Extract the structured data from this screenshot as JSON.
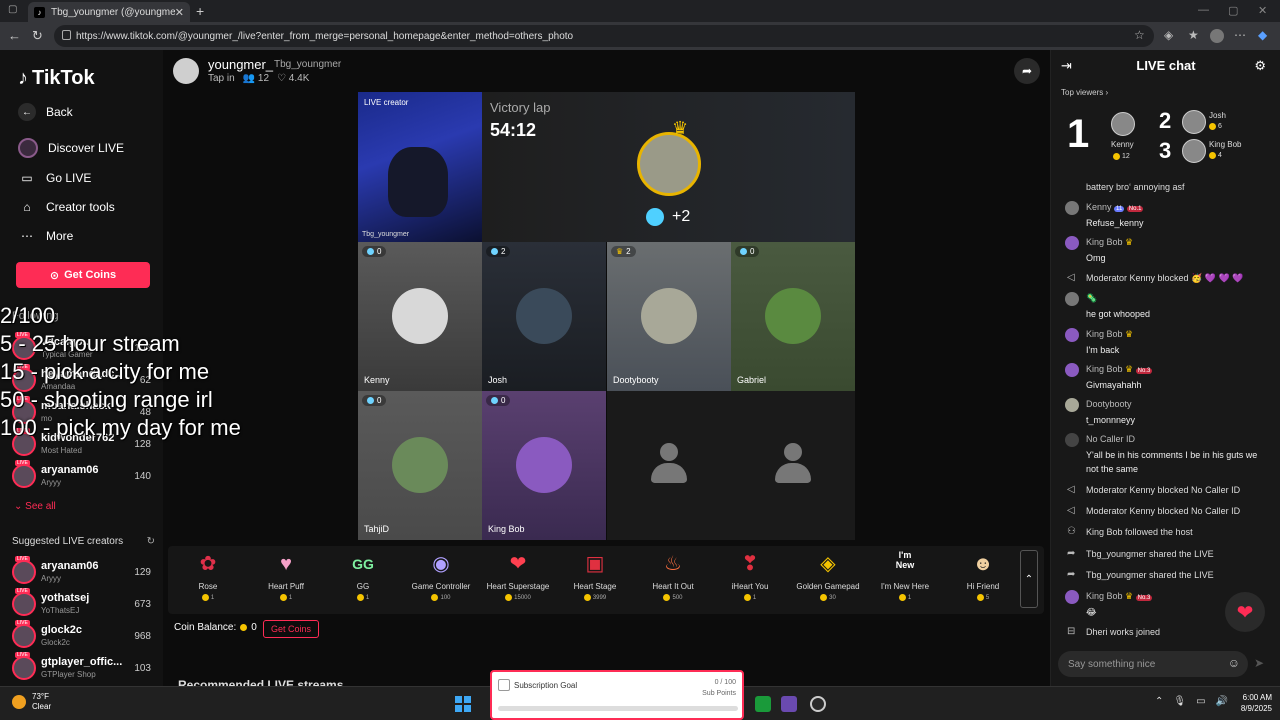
{
  "browser": {
    "tab_title": "Tbg_youngmer (@youngme...",
    "url": "https://www.tiktok.com/@youngmer_/live?enter_from_merge=personal_homepage&enter_method=others_photo"
  },
  "sidebar": {
    "logo": "TikTok",
    "nav": [
      {
        "label": "Back"
      },
      {
        "label": "Discover LIVE"
      },
      {
        "label": "Go LIVE"
      },
      {
        "label": "Creator tools"
      },
      {
        "label": "More"
      }
    ],
    "get_coins": "Get Coins",
    "following_title": "Following",
    "following": [
      {
        "name": "vdcalgo...",
        "sub": "Typical Gamer",
        "count": "106"
      },
      {
        "name": "heyamandadc...",
        "sub": "Amandaa",
        "count": "62"
      },
      {
        "name": "moana.shack",
        "sub": "mo",
        "count": "48"
      },
      {
        "name": "kidwonder762",
        "sub": "Most Hated",
        "count": "128"
      },
      {
        "name": "aryanam06",
        "sub": "Aryyy",
        "count": "140"
      }
    ],
    "see_all": "See all",
    "suggested_title": "Suggested LIVE creators",
    "suggested": [
      {
        "name": "aryanam06",
        "sub": "Aryyy",
        "count": "129"
      },
      {
        "name": "yothatsej",
        "sub": "YoThatsEJ",
        "count": "673"
      },
      {
        "name": "glock2c",
        "sub": "Glock2c",
        "count": "968"
      },
      {
        "name": "gtplayer_offic...",
        "sub": "GTPlayer Shop",
        "count": "103"
      }
    ]
  },
  "overlay": {
    "lines": [
      "2/100",
      "5 - 25 hour stream",
      "15 - pick a city for me",
      "50 - shooting range irl",
      "100 - pick my day for me"
    ]
  },
  "stream": {
    "name": "youngmer_",
    "handle": "Tbg_youngmer",
    "tap_in": "Tap in",
    "viewers": "12",
    "likes": "4.4K",
    "host_label": "LIVE creator",
    "host_name": "Tbg_youngmer",
    "victory_title": "Victory lap",
    "victory_timer": "54:12",
    "victory_plus": "+2",
    "guests": [
      {
        "name": "Kenny",
        "score": "0"
      },
      {
        "name": "Josh",
        "score": "2"
      },
      {
        "name": "Dootybooty",
        "score": "2"
      },
      {
        "name": "Gabriel",
        "score": "0"
      },
      {
        "name": "TahjiD",
        "score": "0"
      },
      {
        "name": "King Bob",
        "score": "0"
      }
    ]
  },
  "gifts": [
    {
      "name": "Rose",
      "price": "1"
    },
    {
      "name": "Heart Puff",
      "price": "1"
    },
    {
      "name": "GG",
      "price": "1"
    },
    {
      "name": "Game Controller",
      "price": "100"
    },
    {
      "name": "Heart Superstage",
      "price": "15000"
    },
    {
      "name": "Heart Stage",
      "price": "3999"
    },
    {
      "name": "Heart It Out",
      "price": "500"
    },
    {
      "name": "iHeart You",
      "price": "1"
    },
    {
      "name": "Golden Gamepad",
      "price": "30"
    },
    {
      "name": "I'm New Here",
      "price": "1"
    },
    {
      "name": "Hi Friend",
      "price": "5"
    }
  ],
  "balance_label": "Coin Balance:",
  "balance_value": "0",
  "get_coins2": "Get Coins",
  "recommended": "Recommended LIVE streams",
  "subgoal": {
    "title": "Subscription Goal",
    "value": "0 / 100",
    "unit": "Sub Points"
  },
  "chat": {
    "title": "LIVE chat",
    "top_viewers": "Top viewers",
    "top": [
      {
        "rank": "1",
        "name": "Kenny",
        "score": "12"
      },
      {
        "rank": "2",
        "name": "Josh",
        "score": "6"
      },
      {
        "rank": "3",
        "name": "King Bob",
        "score": "4"
      }
    ],
    "messages": [
      {
        "type": "text",
        "user": "",
        "text": "battery bro‘ annoying asf"
      },
      {
        "type": "user",
        "user": "Kenny",
        "badge": "11",
        "rank": "No.1",
        "text": "Refuse_kenny"
      },
      {
        "type": "user",
        "user": "King Bob",
        "text": "Omg"
      },
      {
        "type": "system",
        "text": "Moderator Kenny  blocked 🥳 💜 💜 💜"
      },
      {
        "type": "user",
        "user": "🦠",
        "text": "he got whooped"
      },
      {
        "type": "user",
        "user": "King Bob",
        "text": "I'm back"
      },
      {
        "type": "user",
        "user": "King Bob",
        "rank": "No.3",
        "text": "Givmayahahh"
      },
      {
        "type": "user",
        "user": "Dootybooty",
        "text": "t_monnneyy"
      },
      {
        "type": "user",
        "user": "No Caller ID",
        "text": "Y'all be in his comments I be in his guts we not the same"
      },
      {
        "type": "system",
        "text": "Moderator Kenny  blocked No Caller ID"
      },
      {
        "type": "system",
        "text": "Moderator Kenny  blocked No Caller ID"
      },
      {
        "type": "system",
        "text": "King Bob  followed the host"
      },
      {
        "type": "system",
        "text": "Tbg_youngmer shared the LIVE"
      },
      {
        "type": "system",
        "text": "Tbg_youngmer shared the LIVE"
      },
      {
        "type": "user",
        "user": "King Bob",
        "rank": "No.3",
        "text": "😂"
      },
      {
        "type": "system",
        "text": "Dheri works joined"
      }
    ],
    "input_placeholder": "Say something nice"
  },
  "taskbar": {
    "temp": "73°F",
    "weather": "Clear",
    "time": "6:00 AM",
    "date": "8/9/2025"
  },
  "colors": {
    "accent": "#fe2c55",
    "coin": "#f5c400",
    "bg": "#121212"
  }
}
